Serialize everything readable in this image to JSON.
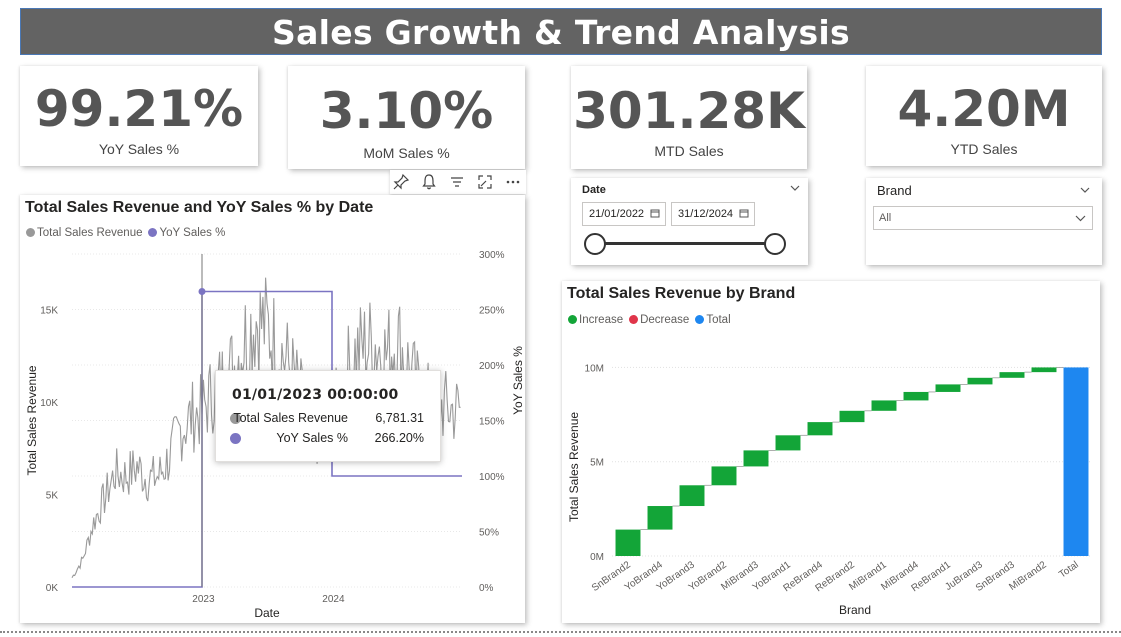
{
  "header": {
    "title": "Sales Growth & Trend Analysis"
  },
  "kpis": [
    {
      "value": "99.21%",
      "label": "YoY Sales %"
    },
    {
      "value": "3.10%",
      "label": "MoM Sales %"
    },
    {
      "value": "301.28K",
      "label": "MTD Sales"
    },
    {
      "value": "4.20M",
      "label": "YTD Sales"
    }
  ],
  "date_slicer": {
    "title": "Date",
    "start": "21/01/2022",
    "end": "31/12/2024",
    "range_fraction": [
      0.0,
      1.0
    ]
  },
  "brand_slicer": {
    "title": "Brand",
    "selected": "All"
  },
  "visual_toolbar": {
    "icons": [
      "pin-icon",
      "bell-icon",
      "filter-icon",
      "focus-mode-icon",
      "more-options-icon"
    ]
  },
  "line_chart": {
    "title": "Total Sales Revenue and YoY Sales % by Date",
    "legend": [
      "Total Sales Revenue",
      "YoY Sales %"
    ],
    "colors": {
      "revenue": "#999999",
      "yoy": "#7b74c2"
    },
    "tooltip": {
      "title": "01/01/2023 00:00:00",
      "rows": [
        {
          "label": "Total Sales Revenue",
          "value": "6,781.31"
        },
        {
          "label": "YoY Sales %",
          "value": "266.20%"
        }
      ]
    }
  },
  "waterfall": {
    "title": "Total Sales Revenue by Brand",
    "legend": [
      "Increase",
      "Decrease",
      "Total"
    ],
    "colors": {
      "increase": "#13a538",
      "decrease": "#e0354a",
      "total": "#1e87f0"
    }
  },
  "chart_data": [
    {
      "type": "line",
      "title": "Total Sales Revenue and YoY Sales % by Date",
      "xlabel": "Date",
      "ylabel": "Total Sales Revenue",
      "y2label": "YoY Sales %",
      "xticks": [
        "2023",
        "2024"
      ],
      "yticks": [
        "0K",
        "5K",
        "10K",
        "15K"
      ],
      "y2ticks": [
        "0%",
        "50%",
        "100%",
        "150%",
        "200%",
        "250%",
        "300%"
      ],
      "ylim": [
        0,
        18000
      ],
      "y2lim": [
        0,
        300
      ],
      "legend_position": "top-left",
      "series": [
        {
          "name": "Total Sales Revenue",
          "x": [
            "2022-01",
            "2022-02",
            "2022-03",
            "2022-04",
            "2022-05",
            "2022-06",
            "2022-07",
            "2022-08",
            "2022-09",
            "2022-10",
            "2022-11",
            "2022-12",
            "2023-01",
            "2023-02",
            "2023-03",
            "2023-04",
            "2023-05",
            "2023-06",
            "2023-07",
            "2023-08",
            "2023-09",
            "2023-10",
            "2023-11",
            "2023-12",
            "2024-01",
            "2024-02",
            "2024-03",
            "2024-04",
            "2024-05",
            "2024-06",
            "2024-07",
            "2024-08",
            "2024-09",
            "2024-10",
            "2024-11",
            "2024-12"
          ],
          "values": [
            500,
            1500,
            3500,
            4800,
            6200,
            6000,
            6500,
            5800,
            6000,
            7000,
            8500,
            9200,
            9500,
            10500,
            11200,
            12000,
            13500,
            14500,
            14000,
            13000,
            12000,
            10500,
            8500,
            8000,
            9000,
            11000,
            12500,
            13000,
            13200,
            12500,
            13500,
            12000,
            10500,
            10000,
            9800,
            9600
          ]
        },
        {
          "name": "YoY Sales %",
          "x": [
            "2022-01",
            "2022-12",
            "2023-01",
            "2023-12",
            "2024-01",
            "2024-12"
          ],
          "values": [
            0,
            0,
            266.2,
            266.2,
            100,
            100
          ]
        }
      ]
    },
    {
      "type": "waterfall",
      "title": "Total Sales Revenue by Brand",
      "xlabel": "Brand",
      "ylabel": "Total Sales Revenue",
      "yticks": [
        "0M",
        "5M",
        "10M"
      ],
      "ylim": [
        0,
        10.5
      ],
      "categories": [
        "SnBrand2",
        "YoBrand4",
        "YoBrand3",
        "YoBrand2",
        "MiBrand3",
        "YoBrand1",
        "ReBrand4",
        "ReBrand2",
        "MiBrand1",
        "MiBrand4",
        "ReBrand1",
        "JuBrand3",
        "SnBrand3",
        "MiBrand2",
        "Total"
      ],
      "values": [
        1.4,
        1.25,
        1.1,
        1.0,
        0.85,
        0.8,
        0.7,
        0.6,
        0.55,
        0.45,
        0.4,
        0.35,
        0.3,
        0.25,
        10.0
      ],
      "legend_position": "top-left"
    }
  ]
}
